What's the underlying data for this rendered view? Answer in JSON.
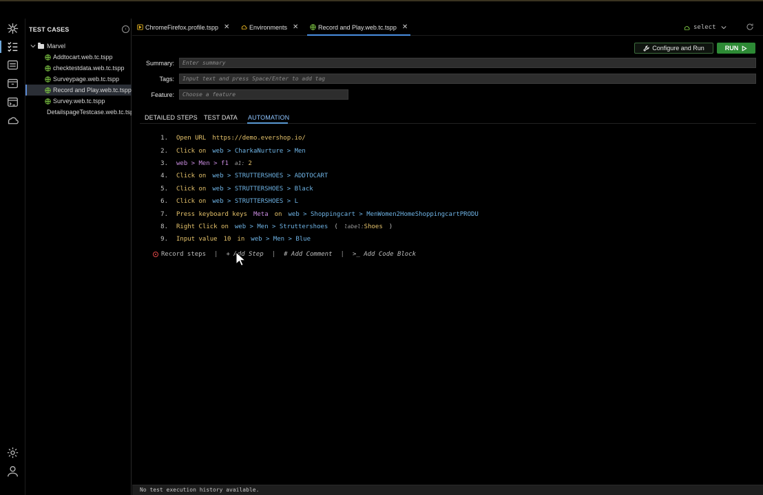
{
  "sidebar": {
    "title": "TEST CASES",
    "folder": "Marvel",
    "files": [
      "Addtocart.web.tc.tspp",
      "checktestdata.web.tc.tspp",
      "Surveypage.web.tc.tspp",
      "Record and Play.web.tc.tspp",
      "Survey.web.tc.tspp",
      "DetailspageTestcase.web.tc.tspp"
    ],
    "selected_file": "Record and Play.web.tc.tspp"
  },
  "tabs": [
    {
      "label": "ChromeFirefox.profile.tspp",
      "icon": "profile-icon"
    },
    {
      "label": "Environments",
      "icon": "cloud-icon"
    },
    {
      "label": "Record and Play.web.tc.tspp",
      "icon": "globe-icon",
      "active": true
    }
  ],
  "env_select": {
    "label": "select"
  },
  "buttons": {
    "configure_run": "Configure and Run",
    "run": "RUN"
  },
  "form": {
    "summary_label": "Summary:",
    "summary_placeholder": "Enter summary",
    "tags_label": "Tags:",
    "tags_placeholder": "Input text and press Space/Enter to add tag",
    "feature_label": "Feature:",
    "feature_placeholder": "Choose a feature"
  },
  "section_tabs": [
    "DETAILED STEPS",
    "TEST DATA",
    "AUTOMATION"
  ],
  "active_section": "AUTOMATION",
  "steps": [
    {
      "n": "1.",
      "parts": {
        "kw": "Open URL",
        "url": "https://demo.evershop.io/"
      }
    },
    {
      "n": "2.",
      "parts": {
        "kw": "Click on",
        "el": "web > CharkaNurture > Men"
      }
    },
    {
      "n": "3.",
      "parts": {
        "pur": "web > Men > f1",
        "attr": "a1:",
        "val": "2"
      }
    },
    {
      "n": "4.",
      "parts": {
        "kw": "Click on",
        "el": "web > STRUTTERSHOES > ADDTOCART"
      }
    },
    {
      "n": "5.",
      "parts": {
        "kw": "Click on",
        "el": "web > STRUTTERSHOES > Black"
      }
    },
    {
      "n": "6.",
      "parts": {
        "kw": "Click on",
        "el": "web > STRUTTERSHOES > L"
      }
    },
    {
      "n": "7.",
      "parts": {
        "kw": "Press keyboard keys",
        "key": "Meta",
        "on": "on",
        "el": "web > Shoppingcart > MenWomen2HomeShoppingcartPRODU"
      }
    },
    {
      "n": "8.",
      "parts": {
        "kw": "Right Click on",
        "el": "web > Men > Struttershoes",
        "open": "(",
        "attr": "label:",
        "val": "Shoes",
        "close": ")"
      }
    },
    {
      "n": "9.",
      "parts": {
        "kw": "Input value",
        "val": "10",
        "in": "in",
        "el": "web > Men > Blue"
      }
    }
  ],
  "actions": {
    "record": "Record steps",
    "add_step": "+ Add Step",
    "add_comment": "# Add Comment",
    "add_code": ">_ Add Code Block",
    "sep": "|"
  },
  "status": "No test execution history available.",
  "colors": {
    "run_green": "#2d8a35",
    "accent_blue": "#4a90e2",
    "keyword_yellow": "#e6c36b",
    "element_blue": "#6fb4e6"
  }
}
